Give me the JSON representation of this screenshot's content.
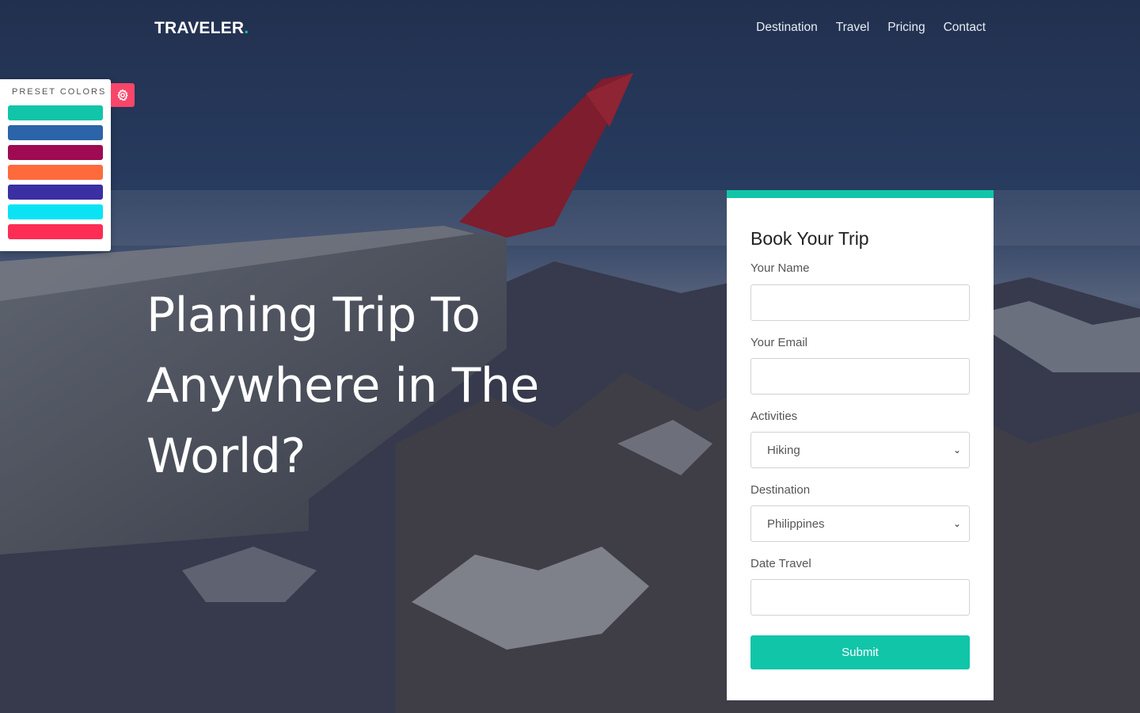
{
  "brand": {
    "name": "TRAVELER",
    "dot": "."
  },
  "nav": {
    "items": [
      "Destination",
      "Travel",
      "Pricing",
      "Contact"
    ]
  },
  "preset": {
    "title": "PRESET COLORS",
    "colors": [
      "#11c5a9",
      "#2b64a8",
      "#9e0b52",
      "#ff6a3d",
      "#3a2fa3",
      "#0be3f5",
      "#fd2d55"
    ]
  },
  "hero": {
    "headline_lines": [
      "Planing Trip To",
      "Anywhere in The",
      "World?"
    ]
  },
  "booking": {
    "title": "Book Your Trip",
    "name_label": "Your Name",
    "email_label": "Your Email",
    "activities_label": "Activities",
    "activities_value": "Hiking",
    "destination_label": "Destination",
    "destination_value": "Philippines",
    "date_label": "Date Travel",
    "submit_label": "Submit"
  },
  "theme": {
    "accent": "#11c5a9",
    "gear_button": "#f8456a"
  }
}
